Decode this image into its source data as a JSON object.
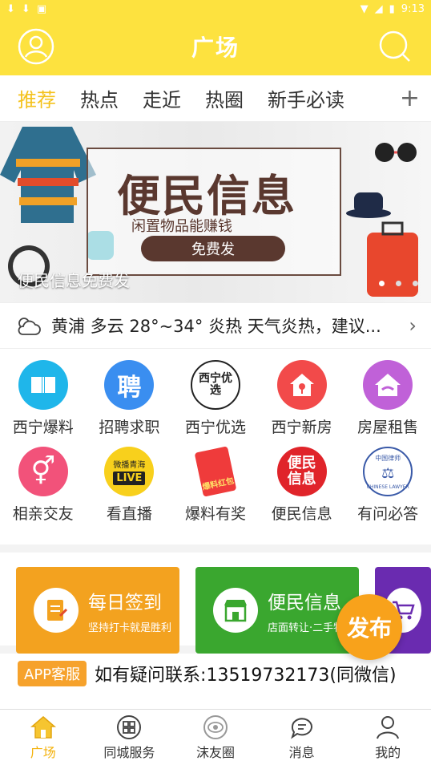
{
  "status_bar": {
    "time": "9:13"
  },
  "header": {
    "title": "广场"
  },
  "tabs": [
    {
      "label": "推荐"
    },
    {
      "label": "热点"
    },
    {
      "label": "走近"
    },
    {
      "label": "热圈"
    },
    {
      "label": "新手必读"
    }
  ],
  "tabs_add": "+",
  "banner": {
    "main_text": "便民信息",
    "sub_text": "闲置物品能赚钱",
    "button_text": "免费发",
    "caption": "便民信息免费发"
  },
  "weather": {
    "text": "黄浦 多云 28°~34° 炎热 天气炎热，建议..."
  },
  "grid": [
    {
      "label": "西宁爆料",
      "icon": "book-icon",
      "color": "#1fb6ea"
    },
    {
      "label": "招聘求职",
      "icon": "hire-icon",
      "glyph": "聘",
      "color": "#3a8ef0"
    },
    {
      "label": "西宁优选",
      "icon": "youxuan-logo-icon",
      "glyph": "西宁优选",
      "color": "#ffffff"
    },
    {
      "label": "西宁新房",
      "icon": "house-key-icon",
      "color": "#f24a4a"
    },
    {
      "label": "房屋租售",
      "icon": "house-handshake-icon",
      "color": "#c061d8"
    },
    {
      "label": "相亲交友",
      "icon": "gender-icon",
      "color": "#f2527a"
    },
    {
      "label": "看直播",
      "icon": "live-icon",
      "glyph": "LIVE",
      "glyph_top": "微播青海",
      "color": "#f8d01c"
    },
    {
      "label": "爆料有奖",
      "icon": "red-envelope-icon",
      "glyph": "爆料红包",
      "color": "#ef3b3b"
    },
    {
      "label": "便民信息",
      "icon": "bianmin-icon",
      "glyph": "便民信息",
      "color": "#e0242a"
    },
    {
      "label": "有问必答",
      "icon": "lawyer-badge-icon",
      "glyph": "CHINESE LAWYER",
      "glyph_top": "中国律师",
      "color": "#ffffff"
    }
  ],
  "cards": [
    {
      "title": "每日签到",
      "sub": "坚持打卡就是胜利",
      "color": "#f3a21f",
      "icon": "checkin-icon"
    },
    {
      "title": "便民信息",
      "sub": "店面转让·二手物品",
      "color": "#3aa72f",
      "icon": "shop-icon"
    },
    {
      "title": "",
      "sub": "",
      "color": "#6a2bb0",
      "icon": "cart-icon"
    }
  ],
  "fab": {
    "label": "发布"
  },
  "contact": {
    "badge": "APP客服",
    "text": "如有疑问联系:13519732173(同微信)"
  },
  "bottom_nav": [
    {
      "label": "广场",
      "active": true
    },
    {
      "label": "同城服务"
    },
    {
      "label": "沫友圈"
    },
    {
      "label": "消息"
    },
    {
      "label": "我的"
    }
  ]
}
